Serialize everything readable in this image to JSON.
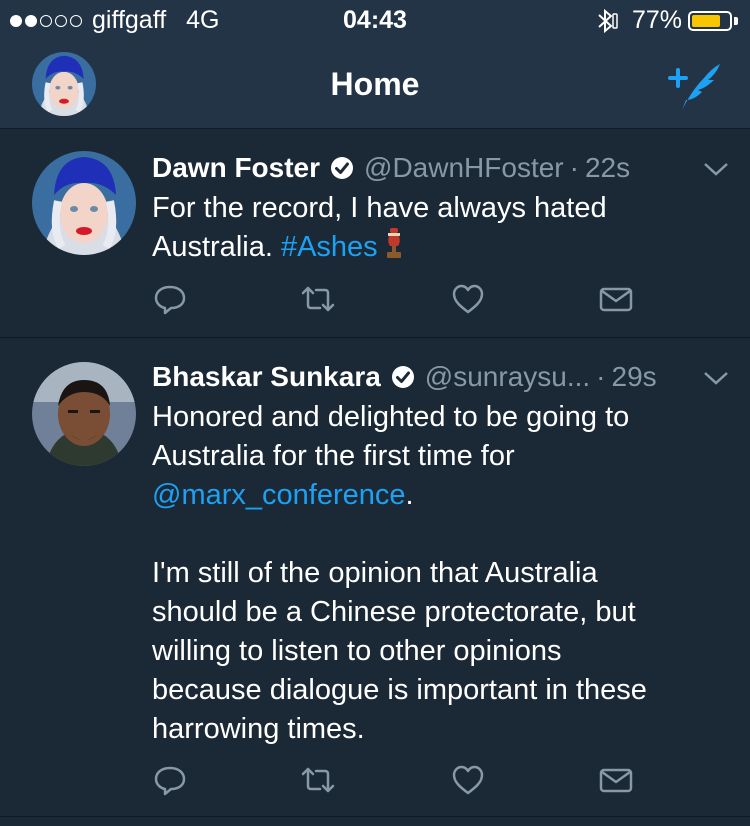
{
  "status_bar": {
    "carrier": "giffgaff",
    "network": "4G",
    "time": "04:43",
    "battery_percent": "77%",
    "battery_level": 0.77,
    "signal_bars_filled": 2,
    "signal_bars_total": 5
  },
  "nav": {
    "title": "Home",
    "compose_icon": "compose-quill-icon"
  },
  "tweets": [
    {
      "name": "Dawn Foster",
      "handle": "@DawnHFoster",
      "separator": "·",
      "time": "22s",
      "text_lines": [
        {
          "before": "For the record, I have always hated",
          "link": "",
          "after": ""
        },
        {
          "before": "Australia. ",
          "link": "#Ashes",
          "after": ""
        }
      ],
      "emoji": "cricket-trophy-urn-icon"
    },
    {
      "name": "Bhaskar Sunkara",
      "handle": "@sunraysu...",
      "separator": "·",
      "time": "29s",
      "text_lines": [
        {
          "before": "Honored and delighted to be going to",
          "link": "",
          "after": ""
        },
        {
          "before": "Australia for the first time for",
          "link": "",
          "after": ""
        },
        {
          "before": "",
          "link": "@marx_conference",
          "after": "."
        },
        {
          "before": "",
          "link": "",
          "after": ""
        },
        {
          "before": "I'm still of the opinion that Australia",
          "link": "",
          "after": ""
        },
        {
          "before": "should be a Chinese protectorate, but",
          "link": "",
          "after": ""
        },
        {
          "before": "willing to listen to other opinions",
          "link": "",
          "after": ""
        },
        {
          "before": "because dialogue is important in these",
          "link": "",
          "after": ""
        },
        {
          "before": "harrowing times.",
          "link": "",
          "after": ""
        }
      ]
    }
  ],
  "colors": {
    "background": "#1b2836",
    "bar": "#243447",
    "accent": "#1da1f2",
    "muted": "#8899a6",
    "battery": "#f7c600"
  }
}
